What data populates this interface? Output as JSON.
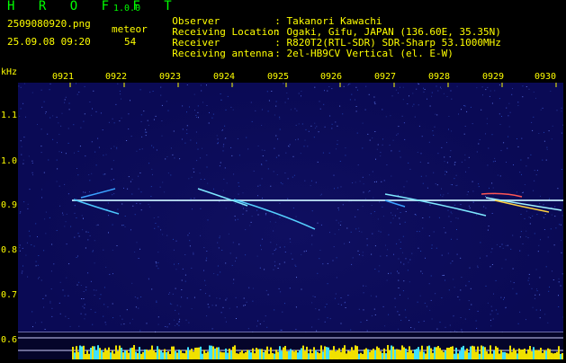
{
  "header": {
    "brand": "H R O F F T",
    "version": "1.0.0",
    "filename": "2509080920.png",
    "meteor_label": "meteor",
    "datetime": "25.09.08 09:20",
    "meteor_count": "54"
  },
  "info": [
    {
      "key": "Observer",
      "value": ": Takanori Kawachi"
    },
    {
      "key": "Receiving Location",
      "value": ": Ogaki, Gifu, JAPAN (136.60E, 35.35N)"
    },
    {
      "key": "Receiver",
      "value": ": R820T2(RTL-SDR) SDR-Sharp 53.1000MHz"
    },
    {
      "key": "Receiving antenna",
      "value": ": 2el-HB9CV Vertical (el. E-W)"
    }
  ],
  "axes": {
    "y_unit": "kHz",
    "y_ticks": [
      "1.1",
      "1.0",
      "0.9",
      "0.8",
      "0.7",
      "0.6"
    ],
    "x_ticks": [
      "0921",
      "0922",
      "0923",
      "0924",
      "0925",
      "0926",
      "0927",
      "0928",
      "0929",
      "0930"
    ]
  },
  "colors": {
    "text": "#ffff00",
    "brand": "#00ff00",
    "background": "#0a0a55",
    "carrier": "#c8f0ff"
  }
}
